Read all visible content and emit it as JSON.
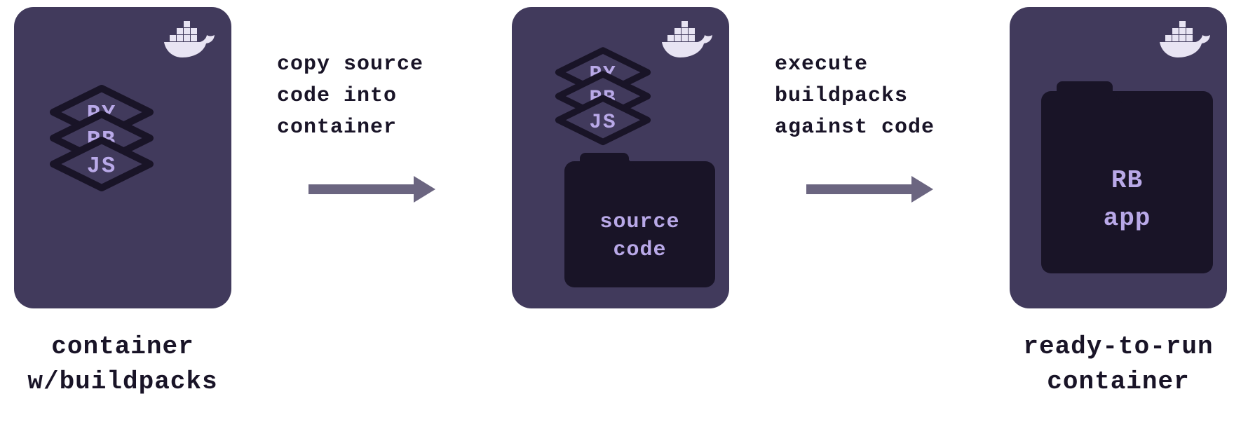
{
  "colors": {
    "card_bg": "#413A5C",
    "dark": "#191427",
    "text_lavender": "#B9A9E8",
    "arrow": "#6B6580"
  },
  "containers": [
    {
      "id": "buildpacks",
      "buildpack_layers": [
        "JS",
        "RB",
        "PY"
      ],
      "folder": null,
      "caption_line1": "container",
      "caption_line2": "w/buildpacks"
    },
    {
      "id": "with-source",
      "buildpack_layers": [
        "JS",
        "RB",
        "PY"
      ],
      "folder": {
        "line1": "source",
        "line2": "code"
      },
      "caption_line1": "",
      "caption_line2": ""
    },
    {
      "id": "ready",
      "buildpack_layers": [],
      "folder": {
        "line1": "RB",
        "line2": "app"
      },
      "caption_line1": "ready-to-run",
      "caption_line2": "container"
    }
  ],
  "steps": [
    {
      "line1": "copy source",
      "line2": "code into",
      "line3": "container"
    },
    {
      "line1": "execute",
      "line2": "buildpacks",
      "line3": "against code"
    }
  ]
}
